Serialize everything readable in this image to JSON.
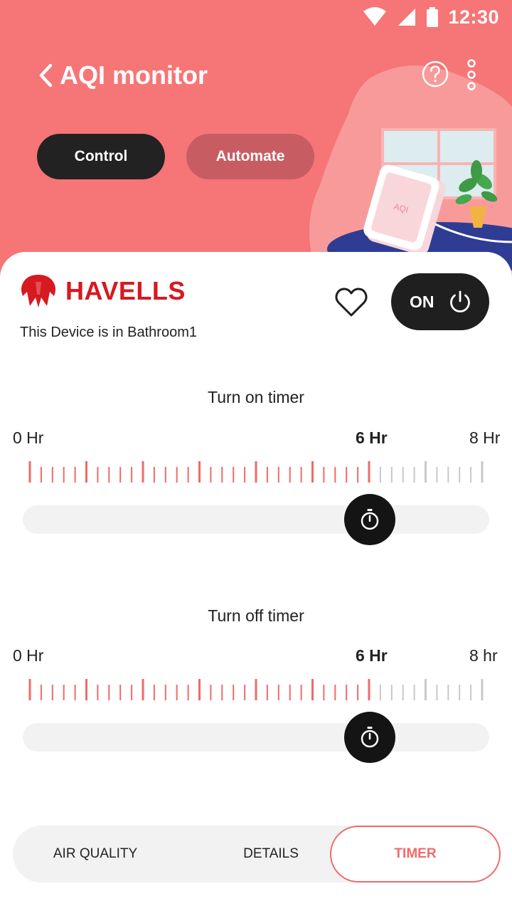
{
  "status_bar": {
    "time": "12:30"
  },
  "header": {
    "title": "AQI monitor",
    "mode_tabs": {
      "control": "Control",
      "automate": "Automate"
    },
    "illustration_device_label": "AQI"
  },
  "device": {
    "brand": "HAVELLS",
    "location": "This Device is in Bathroom1",
    "power_label": "ON",
    "power_on": true
  },
  "timers": {
    "on": {
      "title": "Turn on timer",
      "min_label": "0 Hr",
      "current_label": "6 Hr",
      "max_label": "8 Hr",
      "value_hours": 6,
      "max_hours": 8
    },
    "off": {
      "title": "Turn off timer",
      "min_label": "0 Hr",
      "current_label": "6 Hr",
      "max_label": "8 hr",
      "value_hours": 6,
      "max_hours": 8
    }
  },
  "bottom_tabs": {
    "air_quality": "AIR QUALITY",
    "details": "DETAILS",
    "timer": "TIMER",
    "active": "TIMER"
  },
  "colors": {
    "header_bg": "#f67576",
    "accent_red": "#f06a6a",
    "brand_red": "#d71920",
    "dark": "#1f1f1f",
    "track": "#f2f2f2",
    "tick_inactive": "#c8c8c8"
  }
}
